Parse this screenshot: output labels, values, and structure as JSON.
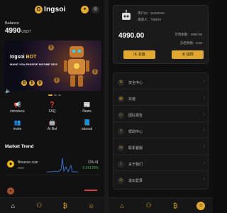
{
  "home": {
    "app_name": "Ingsoi",
    "logo_letter": "G",
    "balance_label": "Balance",
    "balance_value": "4990",
    "balance_unit": "USDT",
    "banner": {
      "brand": "Ingsoi",
      "brand_suffix": "BOT",
      "tagline": "MAKE YOU PASSIVE INCOME 2023"
    },
    "quick_menu": [
      {
        "label": "introduce",
        "icon": "megaphone-icon"
      },
      {
        "label": "FAQ",
        "icon": "faq-icon"
      },
      {
        "label": "News",
        "icon": "news-icon"
      },
      {
        "label": "invite",
        "icon": "invite-icon"
      },
      {
        "label": "AI Bot",
        "icon": "ai-bot-icon"
      },
      {
        "label": "tutorial",
        "icon": "tutorial-icon"
      }
    ],
    "market_title": "Market Trend",
    "market": [
      {
        "name": "Binance coin",
        "symbol": "BNB",
        "price": "215.41",
        "change": "0.34178%"
      }
    ]
  },
  "profile": {
    "uid_line": "用户ID：",
    "uid_value": "11032010",
    "invite_line": "邀请人：",
    "invite_value": "790570",
    "balance": "4990.00",
    "balance_sub": "",
    "stat1_label": "可用余额：",
    "stat1_value": "4990.00",
    "stat2_label": "冻结余额：",
    "stat2_value": "0.00",
    "deposit_label": "充值",
    "withdraw_label": "提现",
    "menu_items": [
      "安全中心",
      "充值",
      "团队报告",
      "帮助中心",
      "联系客服",
      "关于我们",
      "退出登录"
    ]
  },
  "colors": {
    "accent": "#e0a82e",
    "background": "#111111",
    "positive": "#4caf50"
  }
}
